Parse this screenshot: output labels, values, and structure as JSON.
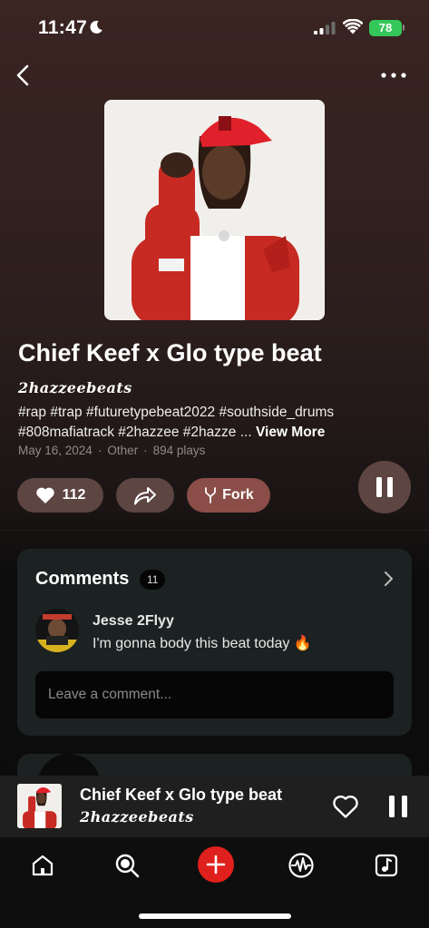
{
  "status_bar": {
    "time": "11:47",
    "battery": "78",
    "icons": [
      "moon-icon",
      "signal-icon",
      "wifi-icon",
      "battery-icon"
    ]
  },
  "nav": {
    "icons": [
      "back-arrow-icon",
      "more-dots-icon"
    ]
  },
  "track": {
    "title": "Chief Keef x Glo type beat",
    "artist": "2hazzeebeats",
    "tags": "#rap #trap #futuretypebeat2022 #southside_drums #808mafiatrack #2hazzee #2hazze ...",
    "view_more": "View More",
    "date": "May 16, 2024",
    "separator": "·",
    "genre": "Other",
    "plays": "894 plays"
  },
  "actions": {
    "likes": "112",
    "fork_label": "Fork",
    "icons": [
      "heart-icon",
      "share-icon",
      "fork-icon",
      "pause-icon"
    ]
  },
  "comments": {
    "title": "Comments",
    "count": "11",
    "items": [
      {
        "user": "Jesse 2Flyy",
        "text": "I'm gonna body this beat today 🔥"
      }
    ],
    "input_placeholder": "Leave a comment..."
  },
  "mini_player": {
    "title": "Chief Keef x Glo type beat",
    "artist": "2hazzeebeats",
    "icons": [
      "heart-outline-icon",
      "pause-icon"
    ]
  },
  "tab_bar": {
    "tabs": [
      "home-icon",
      "search-icon",
      "add-icon",
      "activity-icon",
      "library-icon"
    ]
  },
  "colors": {
    "accent_red": "#e0201c",
    "pill_brown": "#5d4542",
    "fork_red": "#8a4d47",
    "card_bg": "#1c2122",
    "battery_green": "#34c759"
  }
}
